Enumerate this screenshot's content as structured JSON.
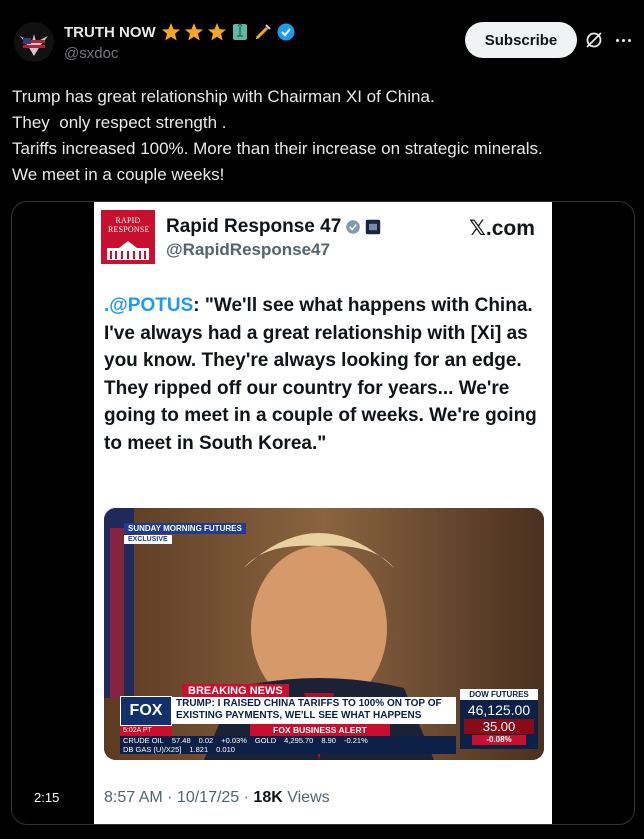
{
  "author": {
    "display_name": "TRUTH NOW",
    "handle": "@sxdoc",
    "badges": [
      "star-icon",
      "star-icon",
      "star-icon",
      "statue-of-liberty-icon",
      "syringe-icon",
      "verified-icon"
    ]
  },
  "actions": {
    "subscribe_label": "Subscribe",
    "grok_icon": "grok-icon",
    "more_icon": "more-icon"
  },
  "post": {
    "lines": [
      "Trump has great relationship with Chairman XI of China.",
      "They  only respect strength .",
      "Tariffs increased 100%. More than their increase on strategic minerals.",
      "We meet in a couple weeks!"
    ]
  },
  "media": {
    "duration": "2:15",
    "embedded_post": {
      "logo_text": "RAPID RESPONSE",
      "name": "Rapid Response 47",
      "handle": "@RapidResponse47",
      "site": "𝕏.com",
      "mention": ".@POTUS",
      "quote": ": \"We'll see what happens with China. I've always had a great relationship with [Xi] as you know. They're always looking for an edge. They ripped off our country for years... We're going to meet in a couple of weeks. We're going to meet in South Korea.\"",
      "time": "8:57 AM",
      "date": "10/17/25",
      "views": "18K",
      "views_label": "Views",
      "separator": " · "
    },
    "broadcast": {
      "show": "SUNDAY MORNING FUTURES",
      "exclusive": "EXCLUSIVE",
      "breaking": "BREAKING NEWS",
      "network": "FOX",
      "network_sub": "BUSINESS",
      "headline": "TRUMP: I RAISED CHINA TARIFFS TO 100% ON TOP OF EXISTING PAYMENTS, WE'LL SEE WHAT HAPPENS",
      "alert": "FOX BUSINESS ALERT",
      "time_tag": "5:02A PT",
      "ticker_row1": [
        "CRUDE OIL",
        "57.48",
        "0.02",
        "+0.03%",
        "GOLD",
        "4,295.70",
        "8.90",
        "-0.21%"
      ],
      "ticker_row2": [
        "DB GAS (U)/X25]",
        "1.821",
        "0.010"
      ],
      "dow_label": "DOW FUTURES",
      "dow_value": "46,125.00",
      "dow_change": "35.00",
      "dow_pct": "-0.08%"
    }
  },
  "colors": {
    "background": "#000000",
    "text": "#e7e9ea",
    "muted": "#71767b",
    "link": "#1d9bf0",
    "fox_red": "#c8102e",
    "fox_navy": "#0d2048"
  }
}
